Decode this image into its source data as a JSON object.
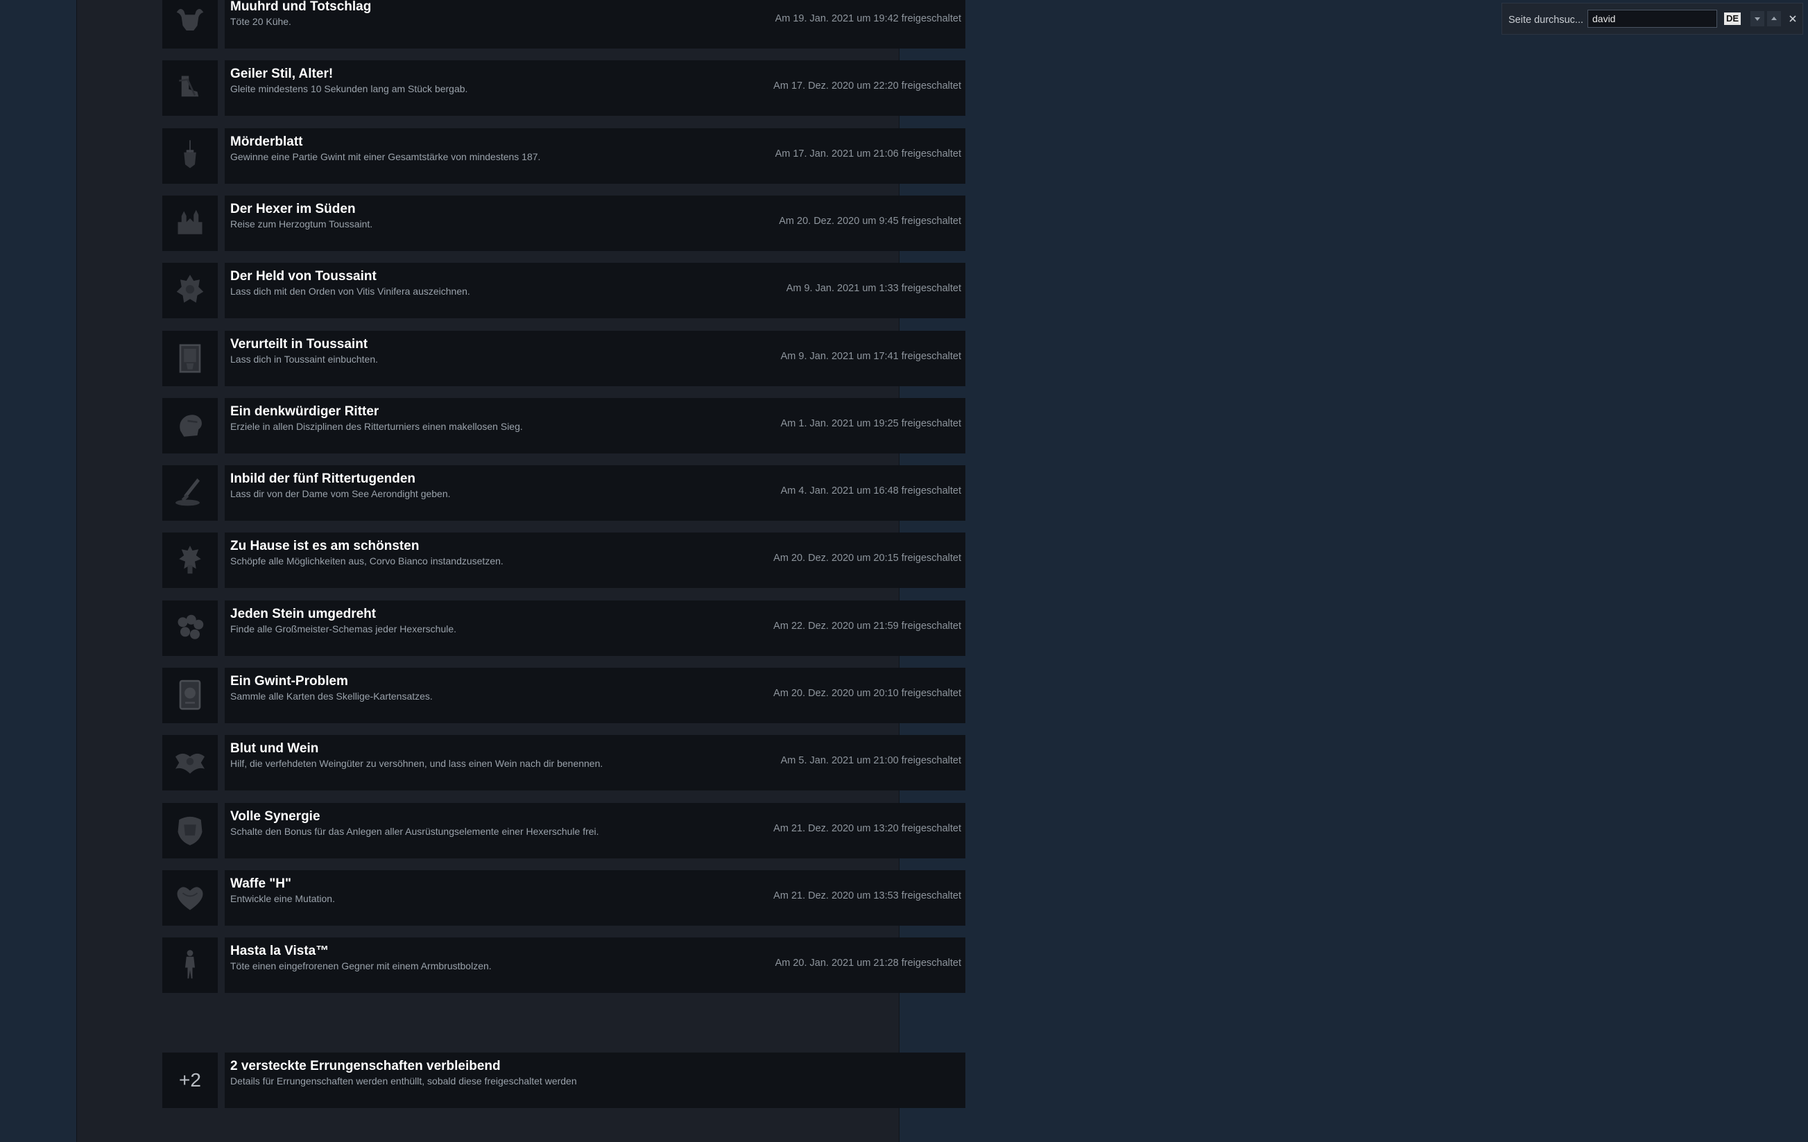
{
  "achievements": [
    {
      "name": "Muuhrd und Totschlag",
      "desc": "Töte 20 Kühe.",
      "unlock": "Am 19. Jan. 2021 um 19:42 freigeschaltet",
      "icon": "bull-skull-icon"
    },
    {
      "name": "Geiler Stil, Alter!",
      "desc": "Gleite mindestens 10 Sekunden lang am Stück bergab.",
      "unlock": "Am 17. Dez. 2020 um 22:20 freigeschaltet",
      "icon": "boot-icon"
    },
    {
      "name": "Mörderblatt",
      "desc": "Gewinne eine Partie Gwint mit einer Gesamtstärke von mindestens 187.",
      "unlock": "Am 17. Jan. 2021 um 21:06 freigeschaltet",
      "icon": "sword-shield-icon"
    },
    {
      "name": "Der Hexer im Süden",
      "desc": "Reise zum Herzogtum Toussaint.",
      "unlock": "Am 20. Dez. 2020 um 9:45 freigeschaltet",
      "icon": "castle-icon"
    },
    {
      "name": "Der Held von Toussaint",
      "desc": "Lass dich mit den Orden von Vitis Vinifera auszeichnen.",
      "unlock": "Am 9. Jan. 2021 um 1:33 freigeschaltet",
      "icon": "medal-icon"
    },
    {
      "name": "Verurteilt in Toussaint",
      "desc": "Lass dich in Toussaint einbuchten.",
      "unlock": "Am 9. Jan. 2021 um 17:41 freigeschaltet",
      "icon": "prison-icon"
    },
    {
      "name": "Ein denkwürdiger Ritter",
      "desc": "Erziele in allen Disziplinen des Ritterturniers einen makellosen Sieg.",
      "unlock": "Am 1. Jan. 2021 um 19:25 freigeschaltet",
      "icon": "knight-helmet-icon"
    },
    {
      "name": "Inbild der fünf Rittertugenden",
      "desc": "Lass dir von der Dame vom See Aerondight geben.",
      "unlock": "Am 4. Jan. 2021 um 16:48 freigeschaltet",
      "icon": "sword-in-lake-icon"
    },
    {
      "name": "Zu Hause ist es am schönsten",
      "desc": "Schöpfe alle Möglichkeiten aus, Corvo Bianco instandzusetzen.",
      "unlock": "Am 20. Dez. 2020 um 20:15 freigeschaltet",
      "icon": "estate-icon"
    },
    {
      "name": "Jeden Stein umgedreht",
      "desc": "Finde alle Großmeister-Schemas jeder Hexerschule.",
      "unlock": "Am 22. Dez. 2020 um 21:59 freigeschaltet",
      "icon": "school-medallions-icon"
    },
    {
      "name": "Ein Gwint-Problem",
      "desc": "Sammle alle Karten des Skellige-Kartensatzes.",
      "unlock": "Am 20. Dez. 2020 um 20:10 freigeschaltet",
      "icon": "card-icon"
    },
    {
      "name": "Blut und Wein",
      "desc": "Hilf, die verfehdeten Weingüter zu versöhnen, und lass einen Wein nach dir benennen.",
      "unlock": "Am 5. Jan. 2021 um 21:00 freigeschaltet",
      "icon": "wine-crest-icon"
    },
    {
      "name": "Volle Synergie",
      "desc": "Schalte den Bonus für das Anlegen aller Ausrüstungselemente einer Hexerschule frei.",
      "unlock": "Am 21. Dez. 2020 um 13:20 freigeschaltet",
      "icon": "armor-icon"
    },
    {
      "name": "Waffe \"H\"",
      "desc": "Entwickle eine Mutation.",
      "unlock": "Am 21. Dez. 2020 um 13:53 freigeschaltet",
      "icon": "heart-mutation-icon"
    },
    {
      "name": "Hasta la Vista™",
      "desc": "Töte einen eingefrorenen Gegner mit einem Armbrustbolzen.",
      "unlock": "Am 20. Jan. 2021 um 21:28 freigeschaltet",
      "icon": "frozen-figure-icon"
    }
  ],
  "hidden": {
    "count": "+2",
    "title": "2 versteckte Errungenschaften verbleibend",
    "desc": "Details für Errungenschaften werden enthüllt, sobald diese freigeschaltet werden"
  },
  "findbar": {
    "label": "Seite durchsuc...",
    "value": "david",
    "lang": "DE"
  }
}
